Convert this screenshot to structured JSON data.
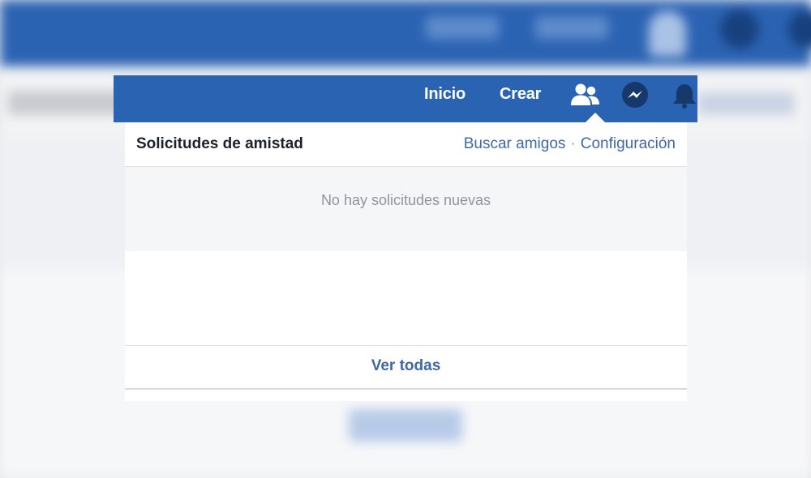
{
  "header": {
    "nav": {
      "home_label": "Inicio",
      "create_label": "Crear"
    },
    "icons": [
      "friends-icon",
      "messenger-icon",
      "notifications-bell-icon"
    ]
  },
  "friend_requests": {
    "title": "Solicitudes de amistad",
    "find_friends_label": "Buscar amigos",
    "separator": "·",
    "settings_label": "Configuración",
    "empty_message": "No hay solicitudes nuevas",
    "see_all_label": "Ver todas"
  },
  "colors": {
    "brand_blue": "#2b63b3",
    "link_blue": "#3f68a8",
    "muted_text": "#90949c",
    "panel_bg": "#f5f6f7"
  }
}
